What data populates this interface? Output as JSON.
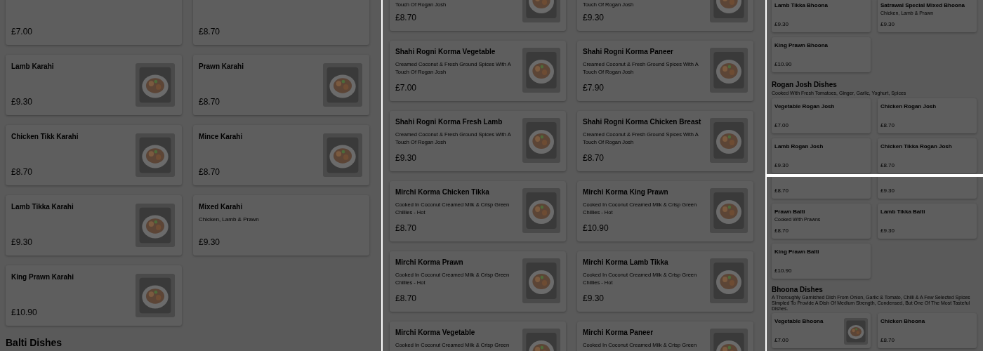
{
  "panels": [
    {
      "blocks": [
        {
          "kind": "grid",
          "cards": [
            {
              "price": "£7.00",
              "photo": false
            },
            {
              "price": "£8.70",
              "photo": false
            },
            {
              "name": "Lamb Karahi",
              "price": "£9.30",
              "photo": true
            },
            {
              "name": "Prawn Karahi",
              "price": "£8.70",
              "photo": true
            },
            {
              "name": "Chicken Tikk Karahi",
              "price": "£8.70",
              "photo": true
            },
            {
              "name": "Mince Karahi",
              "price": "£8.70",
              "photo": true
            },
            {
              "name": "Lamb Tikka Karahi",
              "price": "£9.30",
              "photo": true
            },
            {
              "name": "Mixed Karahi",
              "description": "Chicken, Lamb & Prawn",
              "price": "£9.30",
              "photo": false
            },
            {
              "name": "King Prawn Karahi",
              "price": "£10.90",
              "photo": true
            }
          ]
        },
        {
          "kind": "heading",
          "title": "Balti Dishes"
        }
      ]
    },
    {
      "blocks": [
        {
          "kind": "grid",
          "cards": [
            {
              "description": "Touch Of Rogan Josh",
              "price": "£8.70",
              "photo": true
            },
            {
              "description": "Touch Of Rogan Josh",
              "price": "£9.30",
              "photo": true
            },
            {
              "name": "Shahi Rogni Korma Vegetable",
              "description": "Creamed Coconut & Fresh Ground Spices With A Touch Of Rogan Josh",
              "price": "£7.00",
              "photo": true
            },
            {
              "name": "Shahi Rogni Korma Paneer",
              "description": "Creamed Coconut & Fresh Ground Spices With A Touch Of Rogan Josh",
              "price": "£7.90",
              "photo": true
            },
            {
              "name": "Shahi Rogni Korma Fresh Lamb",
              "description": "Creamed Coconut & Fresh Ground Spices With A Touch Of Rogan Josh",
              "price": "£9.30",
              "photo": true
            },
            {
              "name": "Shahi Rogni Korma Chicken Breast",
              "description": "Creamed Coconut & Fresh Ground Spices With A Touch Of Rogan Josh",
              "price": "£8.70",
              "photo": true
            },
            {
              "name": "Mirchi Korma Chicken Tikka",
              "description": "Cooked In Coconut Creamed Milk & Crisp Green Chillies - Hot",
              "price": "£8.70",
              "photo": true
            },
            {
              "name": "Mirchi Korma King Prawn",
              "description": "Cooked In Coconut Creamed Milk & Crisp Green Chillies - Hot",
              "price": "£10.90",
              "photo": true
            },
            {
              "name": "Mirchi Korma Prawn",
              "description": "Cooked In Coconut Creamed Milk & Crisp Green Chillies - Hot",
              "price": "£8.70",
              "photo": true
            },
            {
              "name": "Mirchi Korma Lamb Tikka",
              "description": "Cooked In Coconut Creamed Milk & Crisp Green Chillies - Hot",
              "price": "£9.30",
              "photo": true
            },
            {
              "name": "Mirchi Korma Vegetable",
              "description": "Cooked In Coconut Creamed Milk & Crisp Green",
              "photo": true
            },
            {
              "name": "Mirchi Korma Paneer",
              "description": "Cooked In Coconut Creamed Milk & Crisp Green",
              "photo": true
            }
          ]
        }
      ]
    },
    {
      "blocks": [
        {
          "kind": "grid",
          "cards": [
            {
              "name": "Lamb Tikka Bhoona",
              "price": "£9.30",
              "photo": false
            },
            {
              "name": "Satrawal Special Mixed Bhoona",
              "description": "Chicken, Lamb & Prawn",
              "price": "£9.30",
              "photo": false
            },
            {
              "name": "King Prawn Bhoona",
              "price": "£10.90",
              "photo": false
            }
          ]
        },
        {
          "kind": "heading",
          "title": "Rogan Josh Dishes",
          "description": "Cooked With Fresh Tomatoes, Ginger, Garlic, Yoghurt, Spices"
        },
        {
          "kind": "grid",
          "cards": [
            {
              "name": "Vegetable Rogan Josh",
              "price": "£7.00",
              "photo": false
            },
            {
              "name": "Chicken Rogan Josh",
              "price": "£8.70",
              "photo": false
            },
            {
              "name": "Lamb Rogan Josh",
              "price": "£9.30",
              "photo": false
            },
            {
              "name": "Chicken Tikka Rogan Josh",
              "price": "£8.70",
              "photo": false
            }
          ]
        }
      ]
    },
    {
      "blocks": [
        {
          "kind": "grid",
          "cards": [
            {
              "price": "£8.70",
              "photo": false
            },
            {
              "price": "£9.30",
              "photo": false
            },
            {
              "name": "Prawn Balti",
              "description": "Cooked With Prawns",
              "price": "£8.70",
              "photo": false
            },
            {
              "name": "Lamb Tikka Balti",
              "price": "£9.30",
              "photo": false
            },
            {
              "name": "King Prawn Balti",
              "price": "£10.90",
              "photo": false
            }
          ]
        },
        {
          "kind": "heading",
          "title": "Bhoona Dishes",
          "description": "A Thoroughly Garnished Dish From Onion, Garlic & Tomato, Chilli & A Few Selected Spices Simpled To Provide A Dish Of Medium Strength, Condensed, But One Of The Most Tasteful Dishes."
        },
        {
          "kind": "grid",
          "cards": [
            {
              "name": "Vegetable Bhoona",
              "price": "£7.00",
              "photo": true
            },
            {
              "name": "Chicken Bhoona",
              "price": "£8.70",
              "photo": false
            }
          ]
        }
      ]
    }
  ]
}
